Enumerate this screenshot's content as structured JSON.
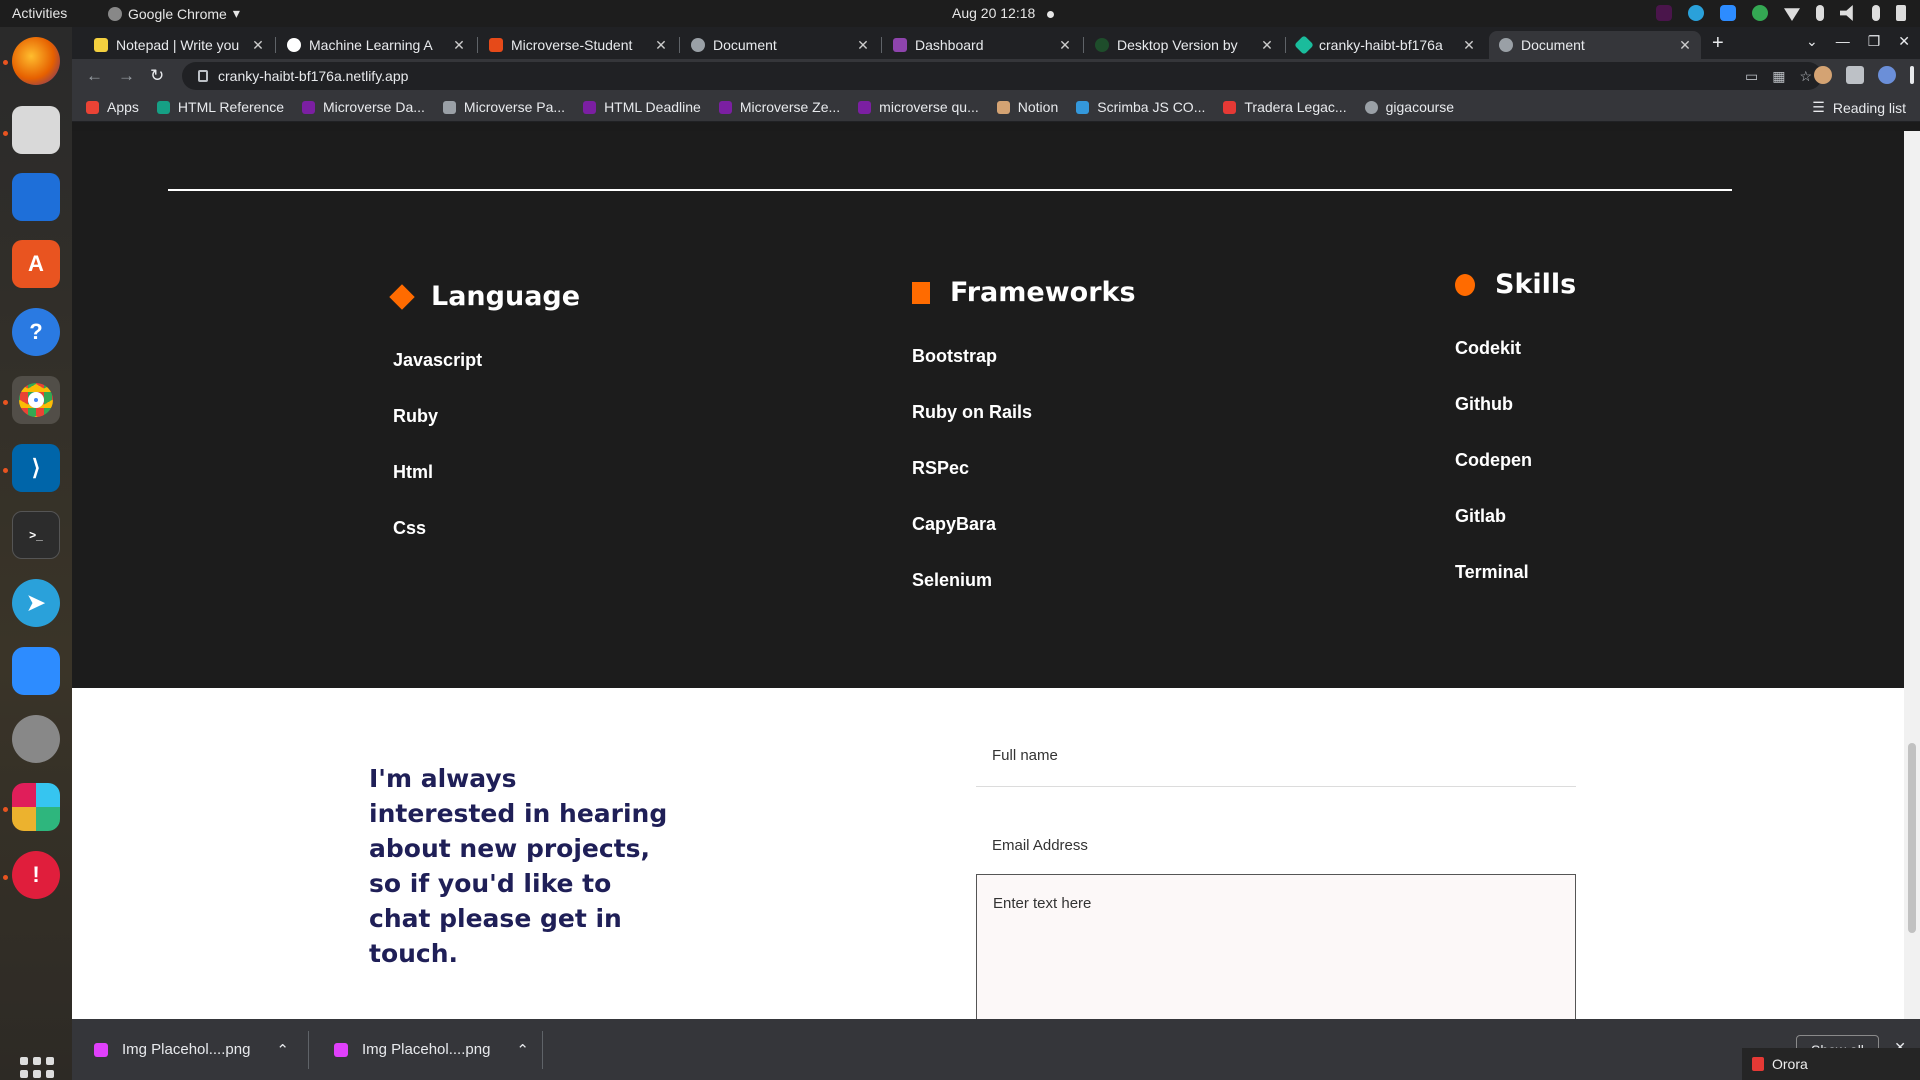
{
  "system": {
    "activities": "Activities",
    "app_name": "Google Chrome",
    "clock": "Aug 20  12:18"
  },
  "browser": {
    "tabs": [
      {
        "label": "Notepad | Write you",
        "icon_color": "#f4d03f"
      },
      {
        "label": "Machine Learning A",
        "icon_color": "#ffffff"
      },
      {
        "label": "Microverse-Student",
        "icon_color": "#e64a19"
      },
      {
        "label": "Document",
        "icon_color": "#9aa0a6"
      },
      {
        "label": "Dashboard",
        "icon_color": "#8e44ad"
      },
      {
        "label": "Desktop Version by",
        "icon_color": "#2ecc71"
      },
      {
        "label": "cranky-haibt-bf176a",
        "icon_color": "#1abc9c"
      },
      {
        "label": "Document",
        "icon_color": "#9aa0a6"
      }
    ],
    "active_tab_index": 7,
    "url": "cranky-haibt-bf176a.netlify.app",
    "bookmarks": [
      {
        "label": "Apps",
        "icon_color": "#ea4335"
      },
      {
        "label": "HTML Reference",
        "icon_color": "#16a085"
      },
      {
        "label": "Microverse Da...",
        "icon_color": "#7b1fa2"
      },
      {
        "label": "Microverse Pa...",
        "icon_color": "#9aa0a6"
      },
      {
        "label": "HTML Deadline",
        "icon_color": "#7b1fa2"
      },
      {
        "label": "Microverse Ze...",
        "icon_color": "#7b1fa2"
      },
      {
        "label": "microverse qu...",
        "icon_color": "#7b1fa2"
      },
      {
        "label": "Notion",
        "icon_color": "#d4a373"
      },
      {
        "label": "Scrimba JS CO...",
        "icon_color": "#3498db"
      },
      {
        "label": "Tradera Legac...",
        "icon_color": "#e53935"
      },
      {
        "label": "gigacourse",
        "icon_color": "#9aa0a6"
      }
    ],
    "reading_list": "Reading list"
  },
  "page": {
    "columns": [
      {
        "title": "Language",
        "bullet": "diamond",
        "items": [
          "Javascript",
          "Ruby",
          "Html",
          "Css"
        ]
      },
      {
        "title": "Frameworks",
        "bullet": "square",
        "items": [
          "Bootstrap",
          "Ruby on Rails",
          "RSPec",
          "CapyBara",
          "Selenium"
        ]
      },
      {
        "title": "Skills",
        "bullet": "circle",
        "items": [
          "Codekit",
          "Github",
          "Codepen",
          "Gitlab",
          "Terminal"
        ]
      }
    ],
    "contact": {
      "text": "I'm always interested in hearing about new projects, so if you'd like to chat please get in touch.",
      "name_placeholder": "Full name",
      "email_placeholder": "Email Address",
      "message_placeholder": "Enter text here"
    },
    "accent_color": "#ff6b00"
  },
  "downloads": {
    "items": [
      "Img Placehol....png",
      "Img Placehol....png"
    ],
    "show_all": "Show all"
  },
  "notification": {
    "label": "Orora"
  }
}
